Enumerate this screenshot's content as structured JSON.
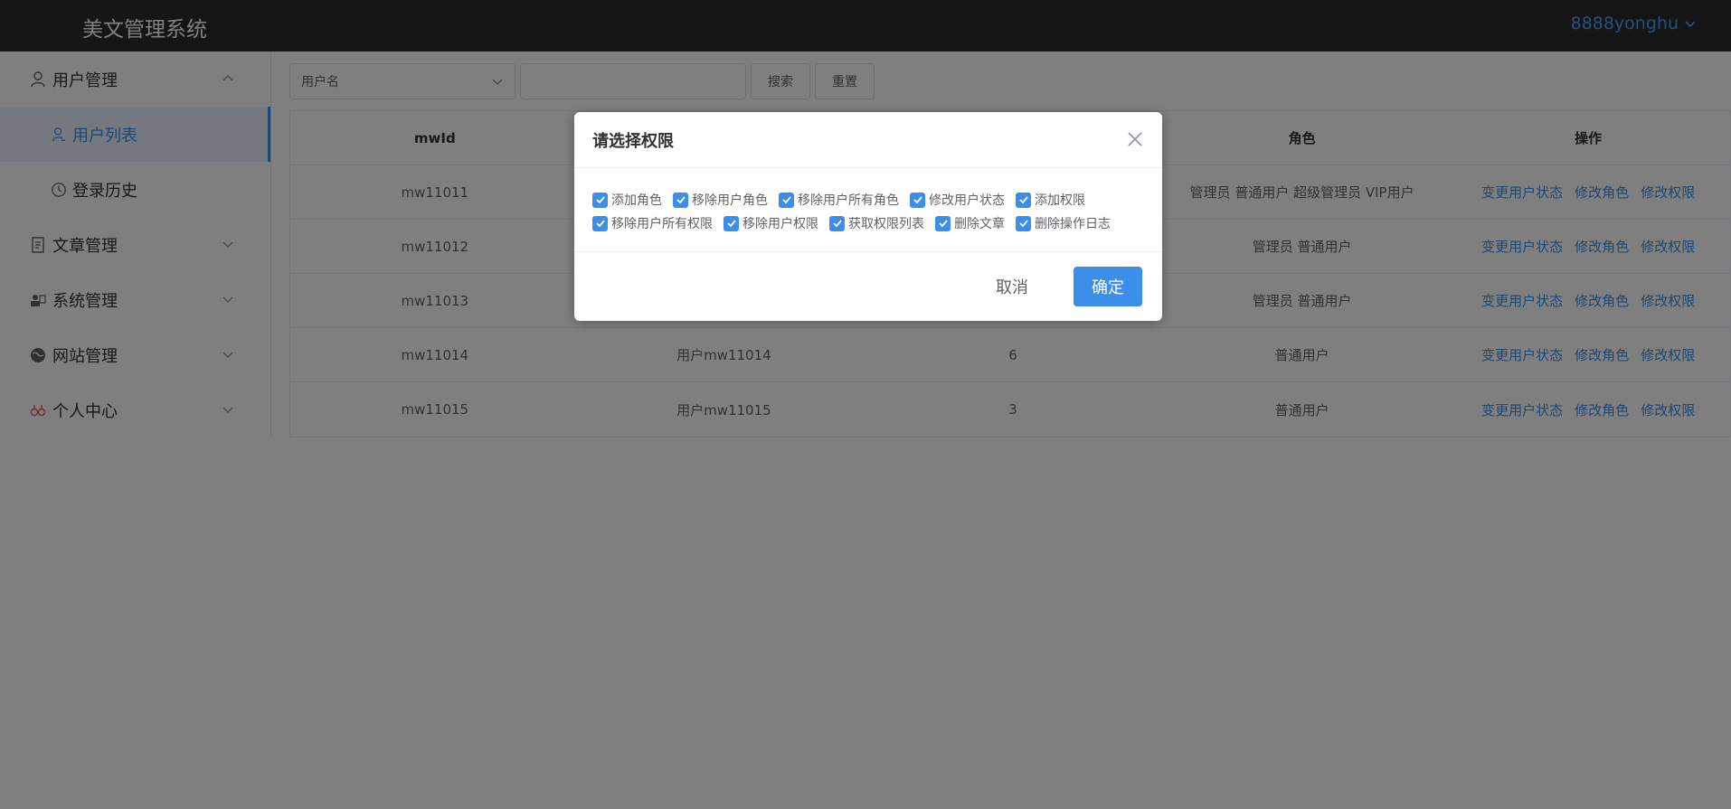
{
  "header": {
    "app_title": "美文管理系统",
    "user_name": "8888yonghu"
  },
  "sidebar": {
    "items": [
      {
        "label": "用户管理",
        "icon": "user-icon",
        "expanded": true
      },
      {
        "label": "用户列表",
        "icon": "user-list-icon",
        "active": true
      },
      {
        "label": "登录历史",
        "icon": "clock-icon"
      },
      {
        "label": "文章管理",
        "icon": "document-icon"
      },
      {
        "label": "系统管理",
        "icon": "system-icon"
      },
      {
        "label": "网站管理",
        "icon": "globe-icon"
      },
      {
        "label": "个人中心",
        "icon": "person-center-icon"
      }
    ]
  },
  "filter": {
    "select_value": "用户名",
    "search_label": "搜索",
    "reset_label": "重置"
  },
  "table": {
    "columns": [
      "mwId",
      "",
      "",
      "角色",
      "操作"
    ],
    "rows": [
      {
        "id": "mw11011",
        "name": "",
        "num": "",
        "roles": "管理员 普通用户 超级管理员 VIP用户"
      },
      {
        "id": "mw11012",
        "name": "",
        "num": "",
        "roles": "管理员 普通用户"
      },
      {
        "id": "mw11013",
        "name": "",
        "num": "",
        "roles": "管理员 普通用户"
      },
      {
        "id": "mw11014",
        "name": "用户mw11014",
        "num": "6",
        "roles": "普通用户"
      },
      {
        "id": "mw11015",
        "name": "用户mw11015",
        "num": "3",
        "roles": "普通用户"
      }
    ],
    "actions": [
      "变更用户状态",
      "修改角色",
      "修改权限"
    ]
  },
  "dialog": {
    "title": "请选择权限",
    "permissions": [
      {
        "label": "添加角色",
        "checked": true
      },
      {
        "label": "移除用户角色",
        "checked": true
      },
      {
        "label": "移除用户所有角色",
        "checked": true
      },
      {
        "label": "修改用户状态",
        "checked": true
      },
      {
        "label": "添加权限",
        "checked": true
      },
      {
        "label": "移除用户所有权限",
        "checked": true
      },
      {
        "label": "移除用户权限",
        "checked": true
      },
      {
        "label": "获取权限列表",
        "checked": true
      },
      {
        "label": "删除文章",
        "checked": true
      },
      {
        "label": "删除操作日志",
        "checked": true
      }
    ],
    "cancel_label": "取消",
    "confirm_label": "确定"
  },
  "colors": {
    "header_bg": "#2b2b2b",
    "accent": "#3b8eea",
    "overlay": "rgba(0,0,0,0.5)"
  }
}
